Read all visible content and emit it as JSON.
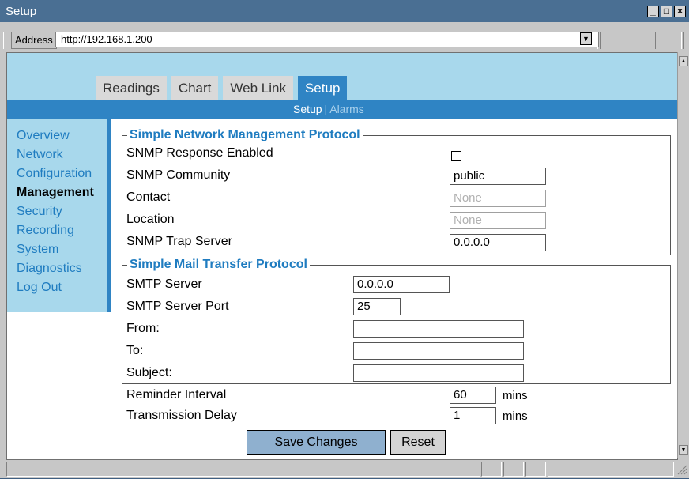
{
  "window": {
    "title": "Setup",
    "controls": [
      "_",
      "□",
      "×"
    ]
  },
  "address_bar": {
    "label": "Address",
    "url": "http://192.168.1.200"
  },
  "tabs": [
    {
      "label": "Readings",
      "active": false
    },
    {
      "label": "Chart",
      "active": false
    },
    {
      "label": "Web Link",
      "active": false
    },
    {
      "label": "Setup",
      "active": true
    }
  ],
  "subnav": {
    "current": "Setup",
    "separator": "|",
    "other": "Alarms"
  },
  "sidebar": {
    "items": [
      {
        "label": "Overview"
      },
      {
        "label": "Network"
      },
      {
        "label": "Configuration"
      },
      {
        "label": "Management",
        "current": true
      },
      {
        "label": "Security"
      },
      {
        "label": "Recording"
      },
      {
        "label": "System"
      },
      {
        "label": "Diagnostics"
      },
      {
        "label": "Log Out"
      }
    ]
  },
  "snmp": {
    "legend": "Simple Network Management Protocol",
    "response_enabled_label": "SNMP Response Enabled",
    "response_enabled": false,
    "community_label": "SNMP Community",
    "community_value": "public",
    "contact_label": "Contact",
    "contact_placeholder": "None",
    "location_label": "Location",
    "location_placeholder": "None",
    "trap_server_label": "SNMP Trap Server",
    "trap_server_value": "0.0.0.0"
  },
  "smtp": {
    "legend": "Simple Mail Transfer Protocol",
    "server_label": "SMTP Server",
    "server_value": "0.0.0.0",
    "port_label": "SMTP Server Port",
    "port_value": "25",
    "from_label": "From:",
    "from_value": "",
    "to_label": "To:",
    "to_value": "",
    "subject_label": "Subject:",
    "subject_value": ""
  },
  "reminder": {
    "label": "Reminder Interval",
    "value": "60",
    "unit": "mins"
  },
  "transmission": {
    "label": "Transmission Delay",
    "value": "1",
    "unit": "mins"
  },
  "buttons": {
    "save": "Save Changes",
    "reset": "Reset"
  }
}
